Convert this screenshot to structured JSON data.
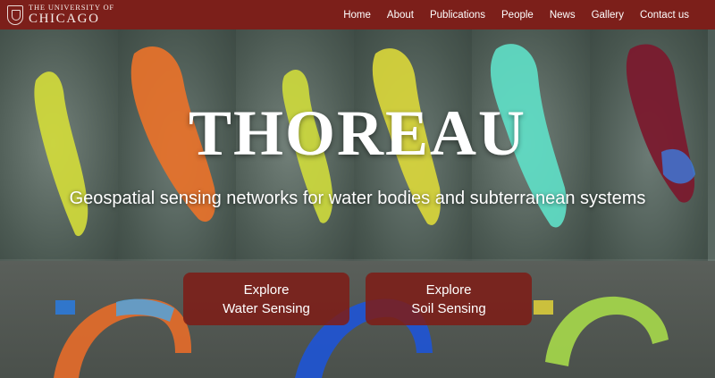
{
  "header": {
    "logo_small": "THE UNIVERSITY OF",
    "logo_big": "CHICAGO",
    "nav": [
      {
        "label": "Home"
      },
      {
        "label": "About"
      },
      {
        "label": "Publications"
      },
      {
        "label": "People"
      },
      {
        "label": "News"
      },
      {
        "label": "Gallery"
      },
      {
        "label": "Contact us"
      }
    ]
  },
  "hero": {
    "title": "THOREAU",
    "subtitle": "Geospatial sensing networks for water bodies and subterranean systems"
  },
  "cta": {
    "water": {
      "line1": "Explore",
      "line2": "Water Sensing"
    },
    "soil": {
      "line1": "Explore",
      "line2": "Soil Sensing"
    }
  },
  "colors": {
    "brand": "#7c1f1a",
    "heatmap_yellow": "#d7e03a",
    "heatmap_orange": "#e8742a",
    "heatmap_cyan": "#5fe0c8",
    "heatmap_maroon": "#7a1a2e",
    "heatmap_blue": "#1e54d6"
  }
}
